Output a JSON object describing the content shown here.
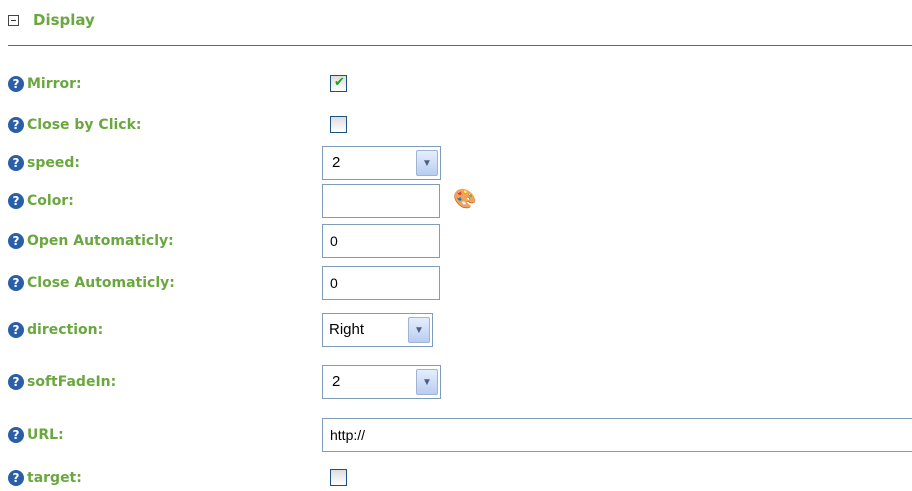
{
  "section": {
    "title": "Display"
  },
  "fields": {
    "mirror": {
      "label": "Mirror:",
      "checked": true
    },
    "close_by_click": {
      "label": "Close by Click:",
      "checked": false
    },
    "speed": {
      "label": "speed:",
      "value": "2"
    },
    "color": {
      "label": "Color:",
      "value": ""
    },
    "open_automaticly": {
      "label": "Open Automaticly:",
      "value": "0"
    },
    "close_automaticly": {
      "label": "Close Automaticly:",
      "value": "0"
    },
    "direction": {
      "label": "direction:",
      "value": "Right"
    },
    "soft_fade_in": {
      "label": "softFadeIn:",
      "value": "2"
    },
    "url": {
      "label": "URL:",
      "value": "http://"
    },
    "target": {
      "label": "target:",
      "checked": false
    }
  },
  "icons": {
    "help": "help-icon",
    "palette": "palette-icon",
    "collapse": "collapse-icon"
  },
  "colors": {
    "label": "#6aa73f",
    "help_icon": "#2a5fa8",
    "check_mark": "#21a121"
  }
}
